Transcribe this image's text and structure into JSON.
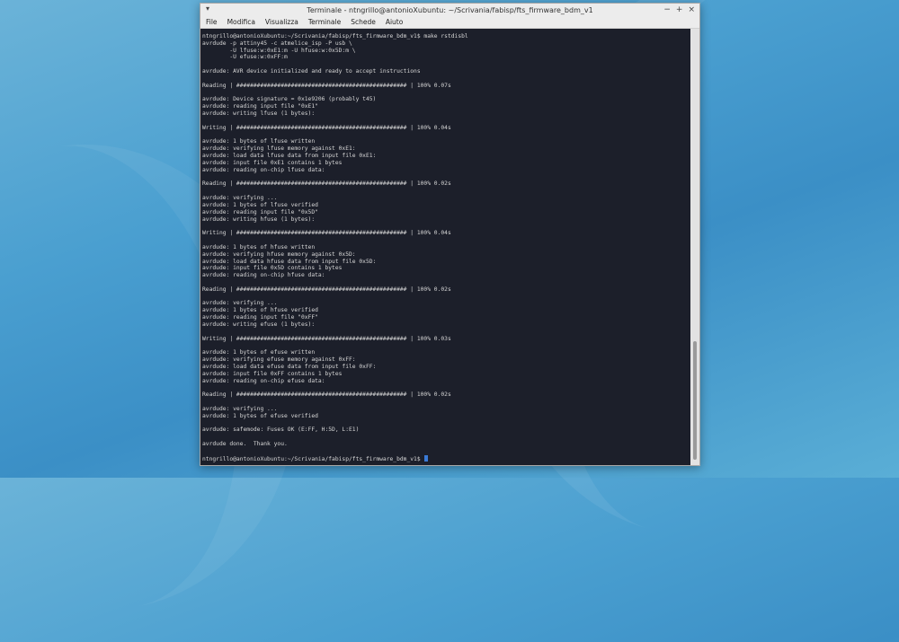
{
  "window": {
    "title": "Terminale - ntngrillo@antonioXubuntu: ~/Scrivania/fabisp/fts_firmware_bdm_v1",
    "menu_icon": "▾",
    "minimize": "−",
    "maximize": "+",
    "close": "×"
  },
  "menu": [
    "File",
    "Modifica",
    "Visualizza",
    "Terminale",
    "Schede",
    "Aiuto"
  ],
  "terminal": {
    "lines": [
      "ntngrillo@antonioXubuntu:~/Scrivania/fabisp/fts_firmware_bdm_v1$ make rstdisbl",
      "avrdude -p attiny45 -c atmelice_isp -P usb \\",
      "        -U lfuse:w:0xE1:m -U hfuse:w:0x5D:m \\",
      "        -U efuse:w:0xFF:m",
      "",
      "avrdude: AVR device initialized and ready to accept instructions",
      "",
      "Reading | ################################################## | 100% 0.07s",
      "",
      "avrdude: Device signature = 0x1e9206 (probably t45)",
      "avrdude: reading input file \"0xE1\"",
      "avrdude: writing lfuse (1 bytes):",
      "",
      "Writing | ################################################## | 100% 0.04s",
      "",
      "avrdude: 1 bytes of lfuse written",
      "avrdude: verifying lfuse memory against 0xE1:",
      "avrdude: load data lfuse data from input file 0xE1:",
      "avrdude: input file 0xE1 contains 1 bytes",
      "avrdude: reading on-chip lfuse data:",
      "",
      "Reading | ################################################## | 100% 0.02s",
      "",
      "avrdude: verifying ...",
      "avrdude: 1 bytes of lfuse verified",
      "avrdude: reading input file \"0x5D\"",
      "avrdude: writing hfuse (1 bytes):",
      "",
      "Writing | ################################################## | 100% 0.04s",
      "",
      "avrdude: 1 bytes of hfuse written",
      "avrdude: verifying hfuse memory against 0x5D:",
      "avrdude: load data hfuse data from input file 0x5D:",
      "avrdude: input file 0x5D contains 1 bytes",
      "avrdude: reading on-chip hfuse data:",
      "",
      "Reading | ################################################## | 100% 0.02s",
      "",
      "avrdude: verifying ...",
      "avrdude: 1 bytes of hfuse verified",
      "avrdude: reading input file \"0xFF\"",
      "avrdude: writing efuse (1 bytes):",
      "",
      "Writing | ################################################## | 100% 0.03s",
      "",
      "avrdude: 1 bytes of efuse written",
      "avrdude: verifying efuse memory against 0xFF:",
      "avrdude: load data efuse data from input file 0xFF:",
      "avrdude: input file 0xFF contains 1 bytes",
      "avrdude: reading on-chip efuse data:",
      "",
      "Reading | ################################################## | 100% 0.02s",
      "",
      "avrdude: verifying ...",
      "avrdude: 1 bytes of efuse verified",
      "",
      "avrdude: safemode: Fuses OK (E:FF, H:5D, L:E1)",
      "",
      "avrdude done.  Thank you.",
      "",
      "ntngrillo@antonioXubuntu:~/Scrivania/fabisp/fts_firmware_bdm_v1$ "
    ]
  },
  "colors": {
    "terminal_bg": "#1c1f2a",
    "terminal_fg": "#d6d6d6",
    "cursor": "#3a7ad6",
    "desktop": "#4a9fd0"
  },
  "icons": {
    "window_menu": "chevron-down-icon",
    "minimize": "minimize-icon",
    "maximize": "maximize-icon",
    "close": "close-icon"
  }
}
